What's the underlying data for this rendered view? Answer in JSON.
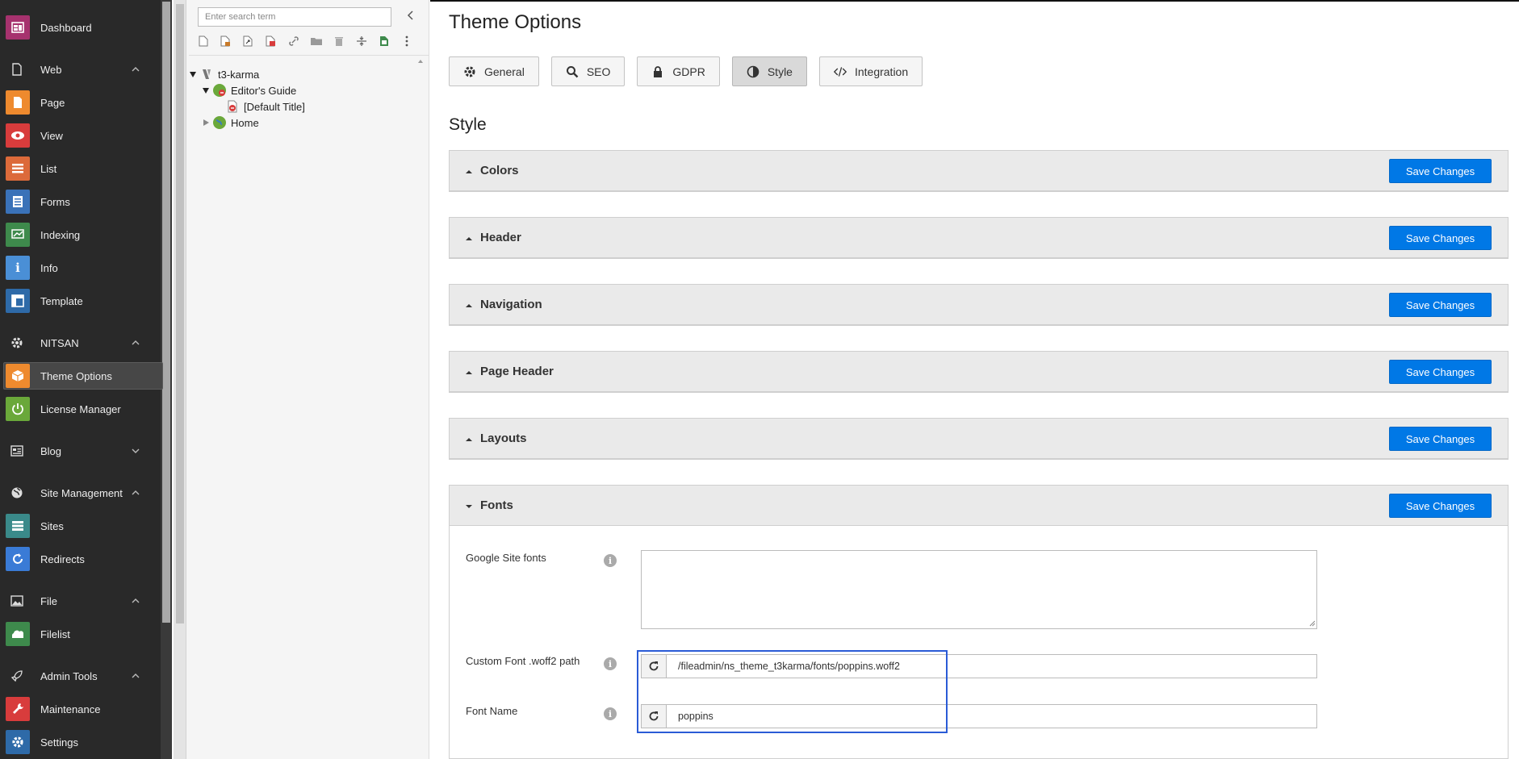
{
  "module_menu": {
    "items": [
      {
        "type": "item",
        "label": "Dashboard",
        "icon": "dashboard-icon",
        "color": "#a6326e"
      },
      {
        "type": "group",
        "label": "Web",
        "icon": "document-icon",
        "expanded": true
      },
      {
        "type": "item",
        "label": "Page",
        "icon": "page-icon",
        "color": "#ee8a2e"
      },
      {
        "type": "item",
        "label": "View",
        "icon": "eye-icon",
        "color": "#d83c3c"
      },
      {
        "type": "item",
        "label": "List",
        "icon": "list-icon",
        "color": "#dc6a3a"
      },
      {
        "type": "item",
        "label": "Forms",
        "icon": "forms-icon",
        "color": "#3a72b8"
      },
      {
        "type": "item",
        "label": "Indexing",
        "icon": "indexing-icon",
        "color": "#3e8a4c"
      },
      {
        "type": "item",
        "label": "Info",
        "icon": "info-icon",
        "color": "#4a8fd6"
      },
      {
        "type": "item",
        "label": "Template",
        "icon": "template-icon",
        "color": "#2e6aa8"
      },
      {
        "type": "group",
        "label": "NITSAN",
        "icon": "gear-icon",
        "expanded": true
      },
      {
        "type": "item",
        "label": "Theme Options",
        "icon": "box-icon",
        "color": "#ee8a2e",
        "active": true
      },
      {
        "type": "item",
        "label": "License Manager",
        "icon": "power-icon",
        "color": "#6aa83a"
      },
      {
        "type": "group",
        "label": "Blog",
        "icon": "blog-icon",
        "expanded": false
      },
      {
        "type": "group",
        "label": "Site Management",
        "icon": "globe-icon",
        "expanded": true
      },
      {
        "type": "item",
        "label": "Sites",
        "icon": "sites-icon",
        "color": "#3a8a8a"
      },
      {
        "type": "item",
        "label": "Redirects",
        "icon": "redirect-icon",
        "color": "#3a7bd6"
      },
      {
        "type": "group",
        "label": "File",
        "icon": "image-icon",
        "expanded": true
      },
      {
        "type": "item",
        "label": "Filelist",
        "icon": "filelist-icon",
        "color": "#3e8a4c"
      },
      {
        "type": "group",
        "label": "Admin Tools",
        "icon": "rocket-icon",
        "expanded": true
      },
      {
        "type": "item",
        "label": "Maintenance",
        "icon": "wrench-icon",
        "color": "#d83c3c"
      },
      {
        "type": "item",
        "label": "Settings",
        "icon": "settings-icon",
        "color": "#2e6aa8"
      }
    ]
  },
  "page_tree": {
    "search_placeholder": "Enter search term",
    "nodes": [
      {
        "label": "t3-karma",
        "level": 0,
        "expanded": true,
        "icon": "typo3-root-icon"
      },
      {
        "label": "Editor's Guide",
        "level": 1,
        "expanded": true,
        "icon": "globe-icon"
      },
      {
        "label": "[Default Title]",
        "level": 2,
        "icon": "page-hidden-icon"
      },
      {
        "label": "Home",
        "level": 1,
        "expanded": false,
        "icon": "globe-icon"
      }
    ]
  },
  "main": {
    "title": "Theme Options",
    "tabs": [
      {
        "label": "General",
        "icon": "gear-icon"
      },
      {
        "label": "SEO",
        "icon": "search-icon"
      },
      {
        "label": "GDPR",
        "icon": "lock-icon"
      },
      {
        "label": "Style",
        "icon": "contrast-icon",
        "active": true
      },
      {
        "label": "Integration",
        "icon": "code-icon"
      }
    ],
    "section_title": "Style",
    "save_label": "Save Changes",
    "panels": [
      {
        "label": "Colors",
        "expanded": false
      },
      {
        "label": "Header",
        "expanded": false
      },
      {
        "label": "Navigation",
        "expanded": false
      },
      {
        "label": "Page Header",
        "expanded": false
      },
      {
        "label": "Layouts",
        "expanded": false
      },
      {
        "label": "Fonts",
        "expanded": true
      }
    ],
    "fonts": {
      "google_label": "Google Site fonts",
      "google_value": "",
      "custom_label": "Custom Font .woff2 path",
      "custom_value": "/fileadmin/ns_theme_t3karma/fonts/poppins.woff2",
      "name_label": "Font Name",
      "name_value": "poppins"
    }
  },
  "colors": {
    "accent": "#0078e6",
    "highlight": "#2a5bd6"
  }
}
